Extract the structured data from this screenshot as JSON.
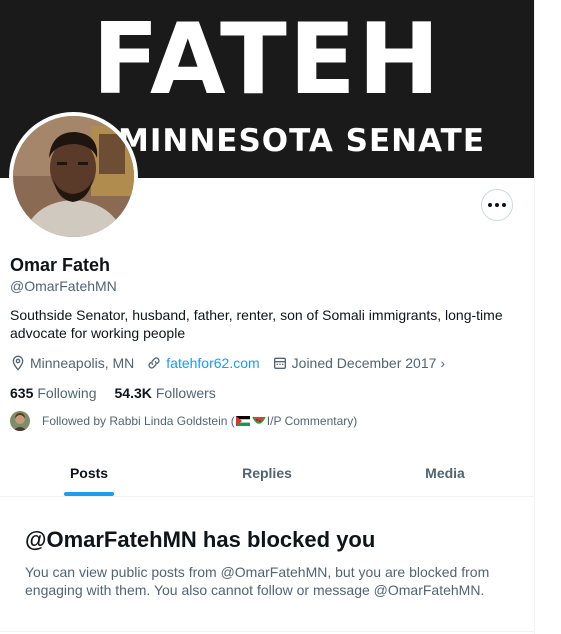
{
  "banner": {
    "title": "FATEH",
    "subtitle": "MINNESOTA SENATE",
    "background": "#1a1a1a"
  },
  "profile": {
    "name": "Omar Fateh",
    "handle": "@OmarFatehMN",
    "bio": "Southside Senator, husband, father, renter, son of Somali immigrants, long-time advocate for working people",
    "location": "Minneapolis, MN",
    "website": "fatehfor62.com",
    "joined": "Joined December 2017"
  },
  "counts": {
    "following_value": "635",
    "following_label": "Following",
    "followers_value": "54.3K",
    "followers_label": "Followers"
  },
  "followed_by": {
    "prefix": "Followed by Rabbi Linda Goldstein (",
    "suffix": "I/P Commentary)"
  },
  "tabs": [
    {
      "label": "Posts",
      "active": true
    },
    {
      "label": "Replies",
      "active": false
    },
    {
      "label": "Media",
      "active": false
    }
  ],
  "blocked": {
    "title": "@OmarFatehMN has blocked you",
    "message": "You can view public posts from @OmarFatehMN, but you are blocked from engaging with them. You also cannot follow or message @OmarFatehMN."
  },
  "icons": [
    "more-icon",
    "location-pin-icon",
    "link-icon",
    "calendar-icon",
    "chevron-right-icon",
    "palestine-flag-icon",
    "watermelon-icon"
  ],
  "colors": {
    "accent": "#1d9bf0",
    "text": "#0f1419",
    "muted": "#536471",
    "border": "#eff3f4"
  }
}
